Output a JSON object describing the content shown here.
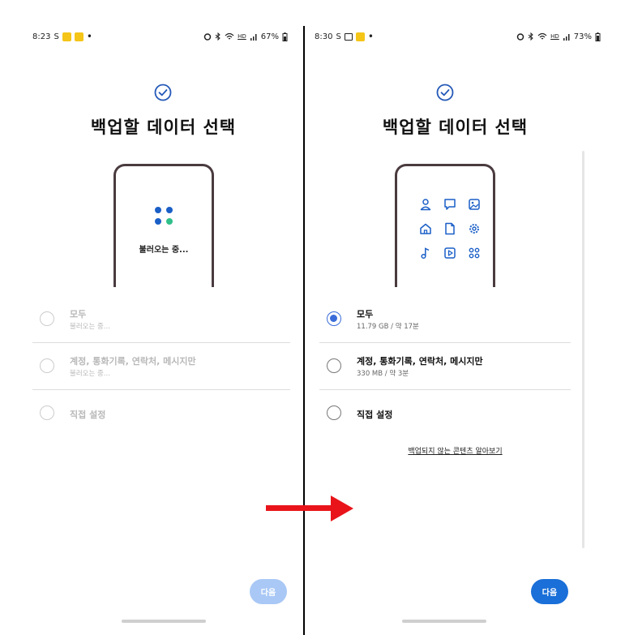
{
  "left_screen": {
    "status_bar": {
      "time": "8:23",
      "s_icon": "S",
      "battery": "67%"
    },
    "title": "백업할 데이터 선택",
    "loading_text": "불러오는 중...",
    "options": [
      {
        "label": "모두",
        "sub": "불러오는 중...",
        "state": "disabled"
      },
      {
        "label": "계정, 통화기록, 연락처, 메시지만",
        "sub": "불러오는 중...",
        "state": "disabled"
      },
      {
        "label": "직접 설정",
        "state": "disabled"
      }
    ],
    "next_button": "다음",
    "colors": {
      "next_button_bg": "#a9c8f5",
      "loader_blue": "#1a5fc7",
      "loader_green": "#2fbf8a"
    }
  },
  "right_screen": {
    "status_bar": {
      "time": "8:30",
      "s_icon": "S",
      "battery": "73%"
    },
    "title": "백업할 데이터 선택",
    "app_icons": [
      "person-icon",
      "chat-icon",
      "image-icon",
      "home-icon",
      "document-icon",
      "settings-icon",
      "music-icon",
      "video-icon",
      "apps-icon"
    ],
    "options": [
      {
        "label": "모두",
        "sub": "11.79 GB / 약 17분",
        "state": "checked"
      },
      {
        "label": "계정, 통화기록, 연락처, 메시지만",
        "sub": "330 MB / 약 3분",
        "state": "unchecked"
      },
      {
        "label": "직접 설정",
        "state": "unchecked"
      }
    ],
    "link": "백업되지 않는 콘텐츠 알아보기",
    "next_button": "다음",
    "colors": {
      "next_button_bg": "#1a6fd8",
      "radio_checked": "#3a6cd9"
    }
  },
  "status_icons": [
    "alarm-icon",
    "bluetooth-icon",
    "wifi-icon",
    "hd-icon",
    "signal-icon",
    "battery-icon"
  ],
  "hd_label": "HD",
  "arrow_color": "#e8141a"
}
